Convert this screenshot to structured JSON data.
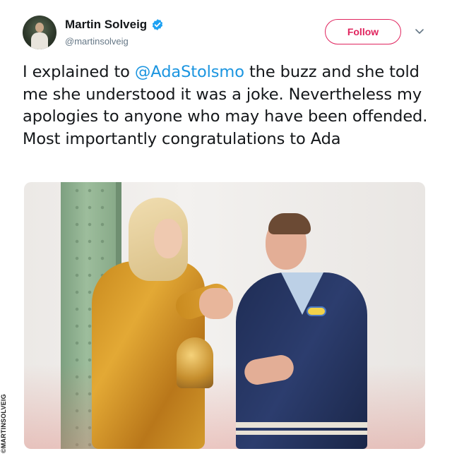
{
  "author": {
    "name": "Martin Solveig",
    "handle": "@martinsolveig",
    "verified": true,
    "avatar": "avatar"
  },
  "header": {
    "follow_label": "Follow",
    "menu_icon": "chevron-down-icon"
  },
  "tweet": {
    "text_before_mention": "I explained to ",
    "mention": "@AdaStolsmo",
    "text_after_mention": " the buzz and she told me she understood it was a joke. Nevertheless my apologies to anyone who may have been offended. Most importantly congratulations to Ada"
  },
  "photo": {
    "credit": "©MARTINSOLVEIG"
  },
  "colors": {
    "follow": "#e0245e",
    "mention": "#1b95e0",
    "verified": "#1da1f2",
    "handle": "#657786"
  }
}
